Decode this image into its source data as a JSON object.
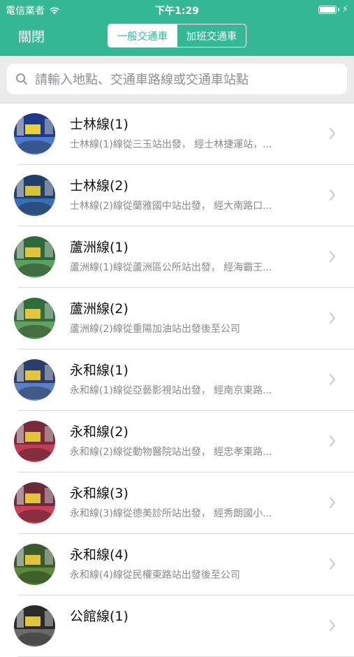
{
  "status": {
    "carrier": "電信業者",
    "time": "下午1:29"
  },
  "nav": {
    "close_label": "關閉",
    "segments": [
      "一般交通車",
      "加班交通車"
    ]
  },
  "search": {
    "placeholder": "請輸入地點、交通車路線或交通車站點"
  },
  "colors": {
    "brand": "#35b894",
    "text": "#111111",
    "subtext": "#8a8a8a"
  },
  "routes": [
    {
      "name": "士林線(1)",
      "desc": "士林線(1)線從三玉站出發， 經士林捷運站，..."
    },
    {
      "name": "士林線(2)",
      "desc": "士林線(2)線從蘭雅國中站出發， 經大南路口..."
    },
    {
      "name": "蘆洲線(1)",
      "desc": "蘆洲線(1)線從蘆洲區公所站出發， 經海霸王..."
    },
    {
      "name": "蘆洲線(2)",
      "desc": "蘆洲線(2)線從重陽加油站出發後至公司"
    },
    {
      "name": "永和線(1)",
      "desc": "永和線(1)線從亞藝影視站出發， 經南京東路..."
    },
    {
      "name": "永和線(2)",
      "desc": "永和線(2)線從動物醫院站出發， 經忠孝東路..."
    },
    {
      "name": "永和線(3)",
      "desc": "永和線(3)線從德美診所站出發， 經秀朗國小..."
    },
    {
      "name": "永和線(4)",
      "desc": "永和線(4)線從民權東路站出發後至公司"
    },
    {
      "name": "公館線(1)",
      "desc": ""
    }
  ]
}
